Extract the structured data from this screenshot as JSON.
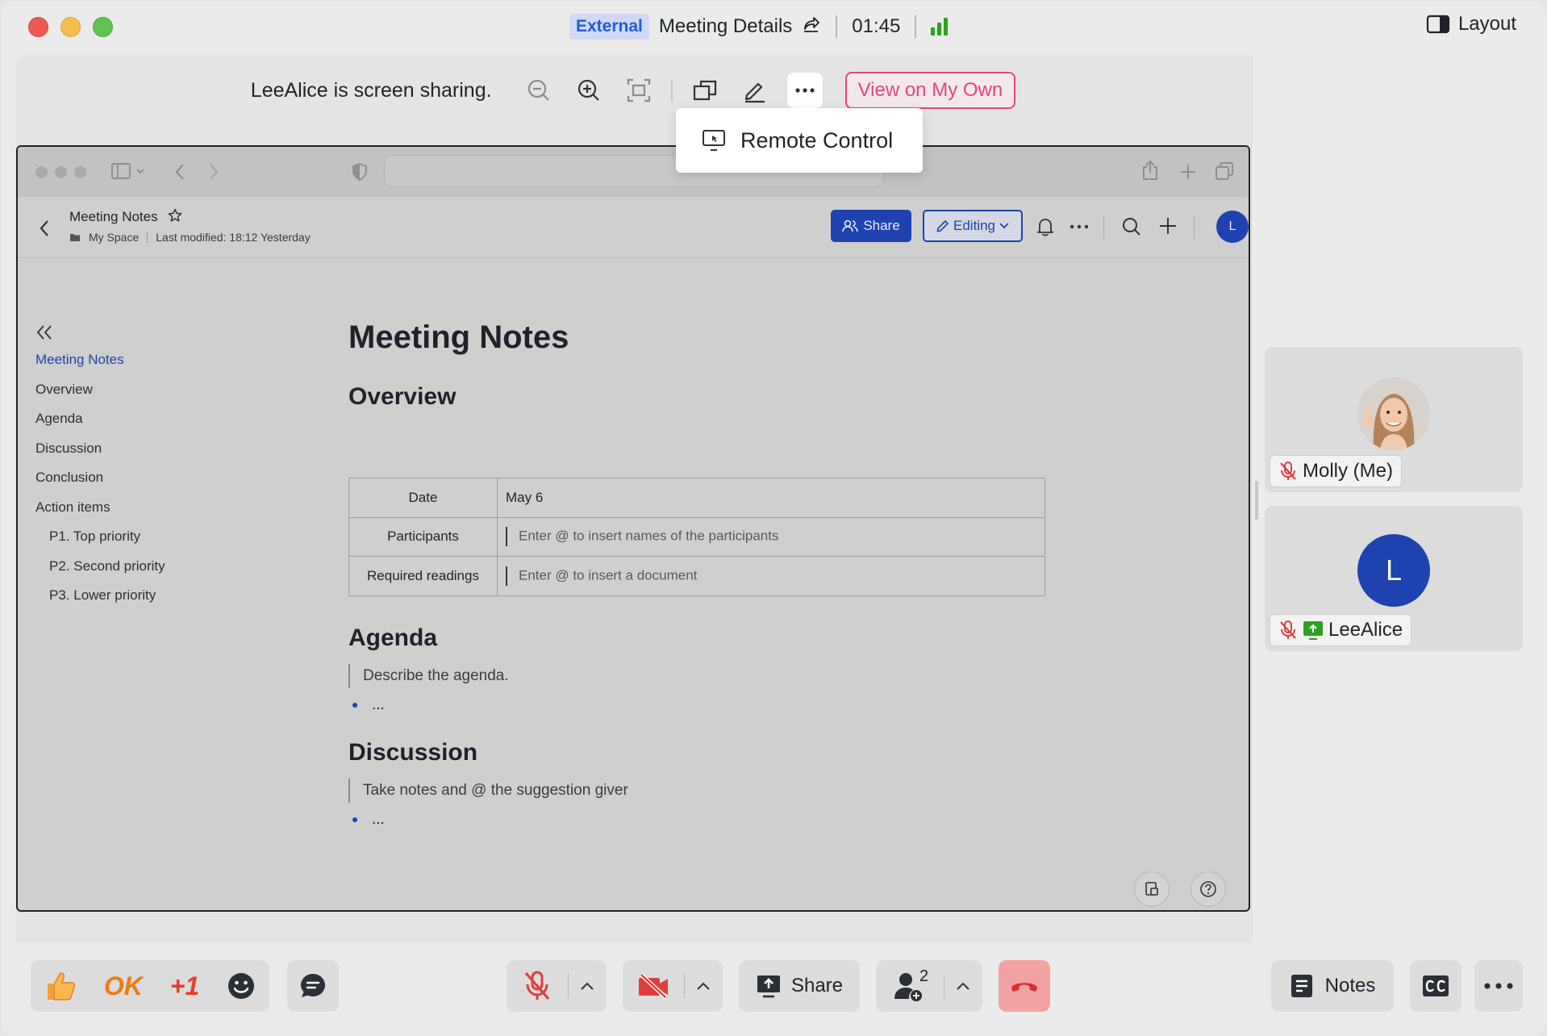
{
  "titlebar": {
    "external_badge": "External",
    "meeting_title": "Meeting Details",
    "timer": "01:45",
    "layout_label": "Layout"
  },
  "share_toolbar": {
    "status_text": "LeeAlice is screen sharing.",
    "view_own_label": "View on My Own",
    "menu": {
      "remote_control_label": "Remote Control"
    }
  },
  "shared_doc": {
    "header": {
      "title": "Meeting Notes",
      "space": "My Space",
      "modified": "Last modified: 18:12 Yesterday",
      "share_label": "Share",
      "editing_label": "Editing",
      "avatar_letter": "L"
    },
    "toc": [
      {
        "label": "Meeting Notes",
        "active": true,
        "sub": false
      },
      {
        "label": "Overview",
        "active": false,
        "sub": false
      },
      {
        "label": "Agenda",
        "active": false,
        "sub": false
      },
      {
        "label": "Discussion",
        "active": false,
        "sub": false
      },
      {
        "label": "Conclusion",
        "active": false,
        "sub": false
      },
      {
        "label": "Action items",
        "active": false,
        "sub": false
      },
      {
        "label": "P1. Top priority",
        "active": false,
        "sub": true
      },
      {
        "label": "P2. Second priority",
        "active": false,
        "sub": true
      },
      {
        "label": "P3. Lower priority",
        "active": false,
        "sub": true
      }
    ],
    "body": {
      "title": "Meeting Notes",
      "overview_heading": "Overview",
      "table": [
        {
          "key": "Date",
          "value": "May 6",
          "placeholder": false
        },
        {
          "key": "Participants",
          "value": "Enter @ to insert names of the participants",
          "placeholder": true
        },
        {
          "key": "Required readings",
          "value": "Enter @ to insert a document",
          "placeholder": true
        }
      ],
      "agenda_heading": "Agenda",
      "agenda_quote": "Describe the agenda.",
      "agenda_bullet": "...",
      "discussion_heading": "Discussion",
      "discussion_quote": "Take notes and @ the suggestion giver",
      "discussion_bullet": "..."
    }
  },
  "participants": [
    {
      "name": "Molly (Me)",
      "muted": true,
      "sharing": false
    },
    {
      "name": "LeeAlice",
      "muted": true,
      "sharing": true,
      "avatar_letter": "L"
    }
  ],
  "bottom": {
    "ok_label": "OK",
    "plus_one_label": "+1",
    "share_label": "Share",
    "participants_count": "2",
    "notes_label": "Notes"
  },
  "colors": {
    "accent_blue": "#1e43b0",
    "view_own_pink": "#e4467b",
    "end_call_red": "#f0a0a0",
    "signal_green": "#2ea121"
  }
}
